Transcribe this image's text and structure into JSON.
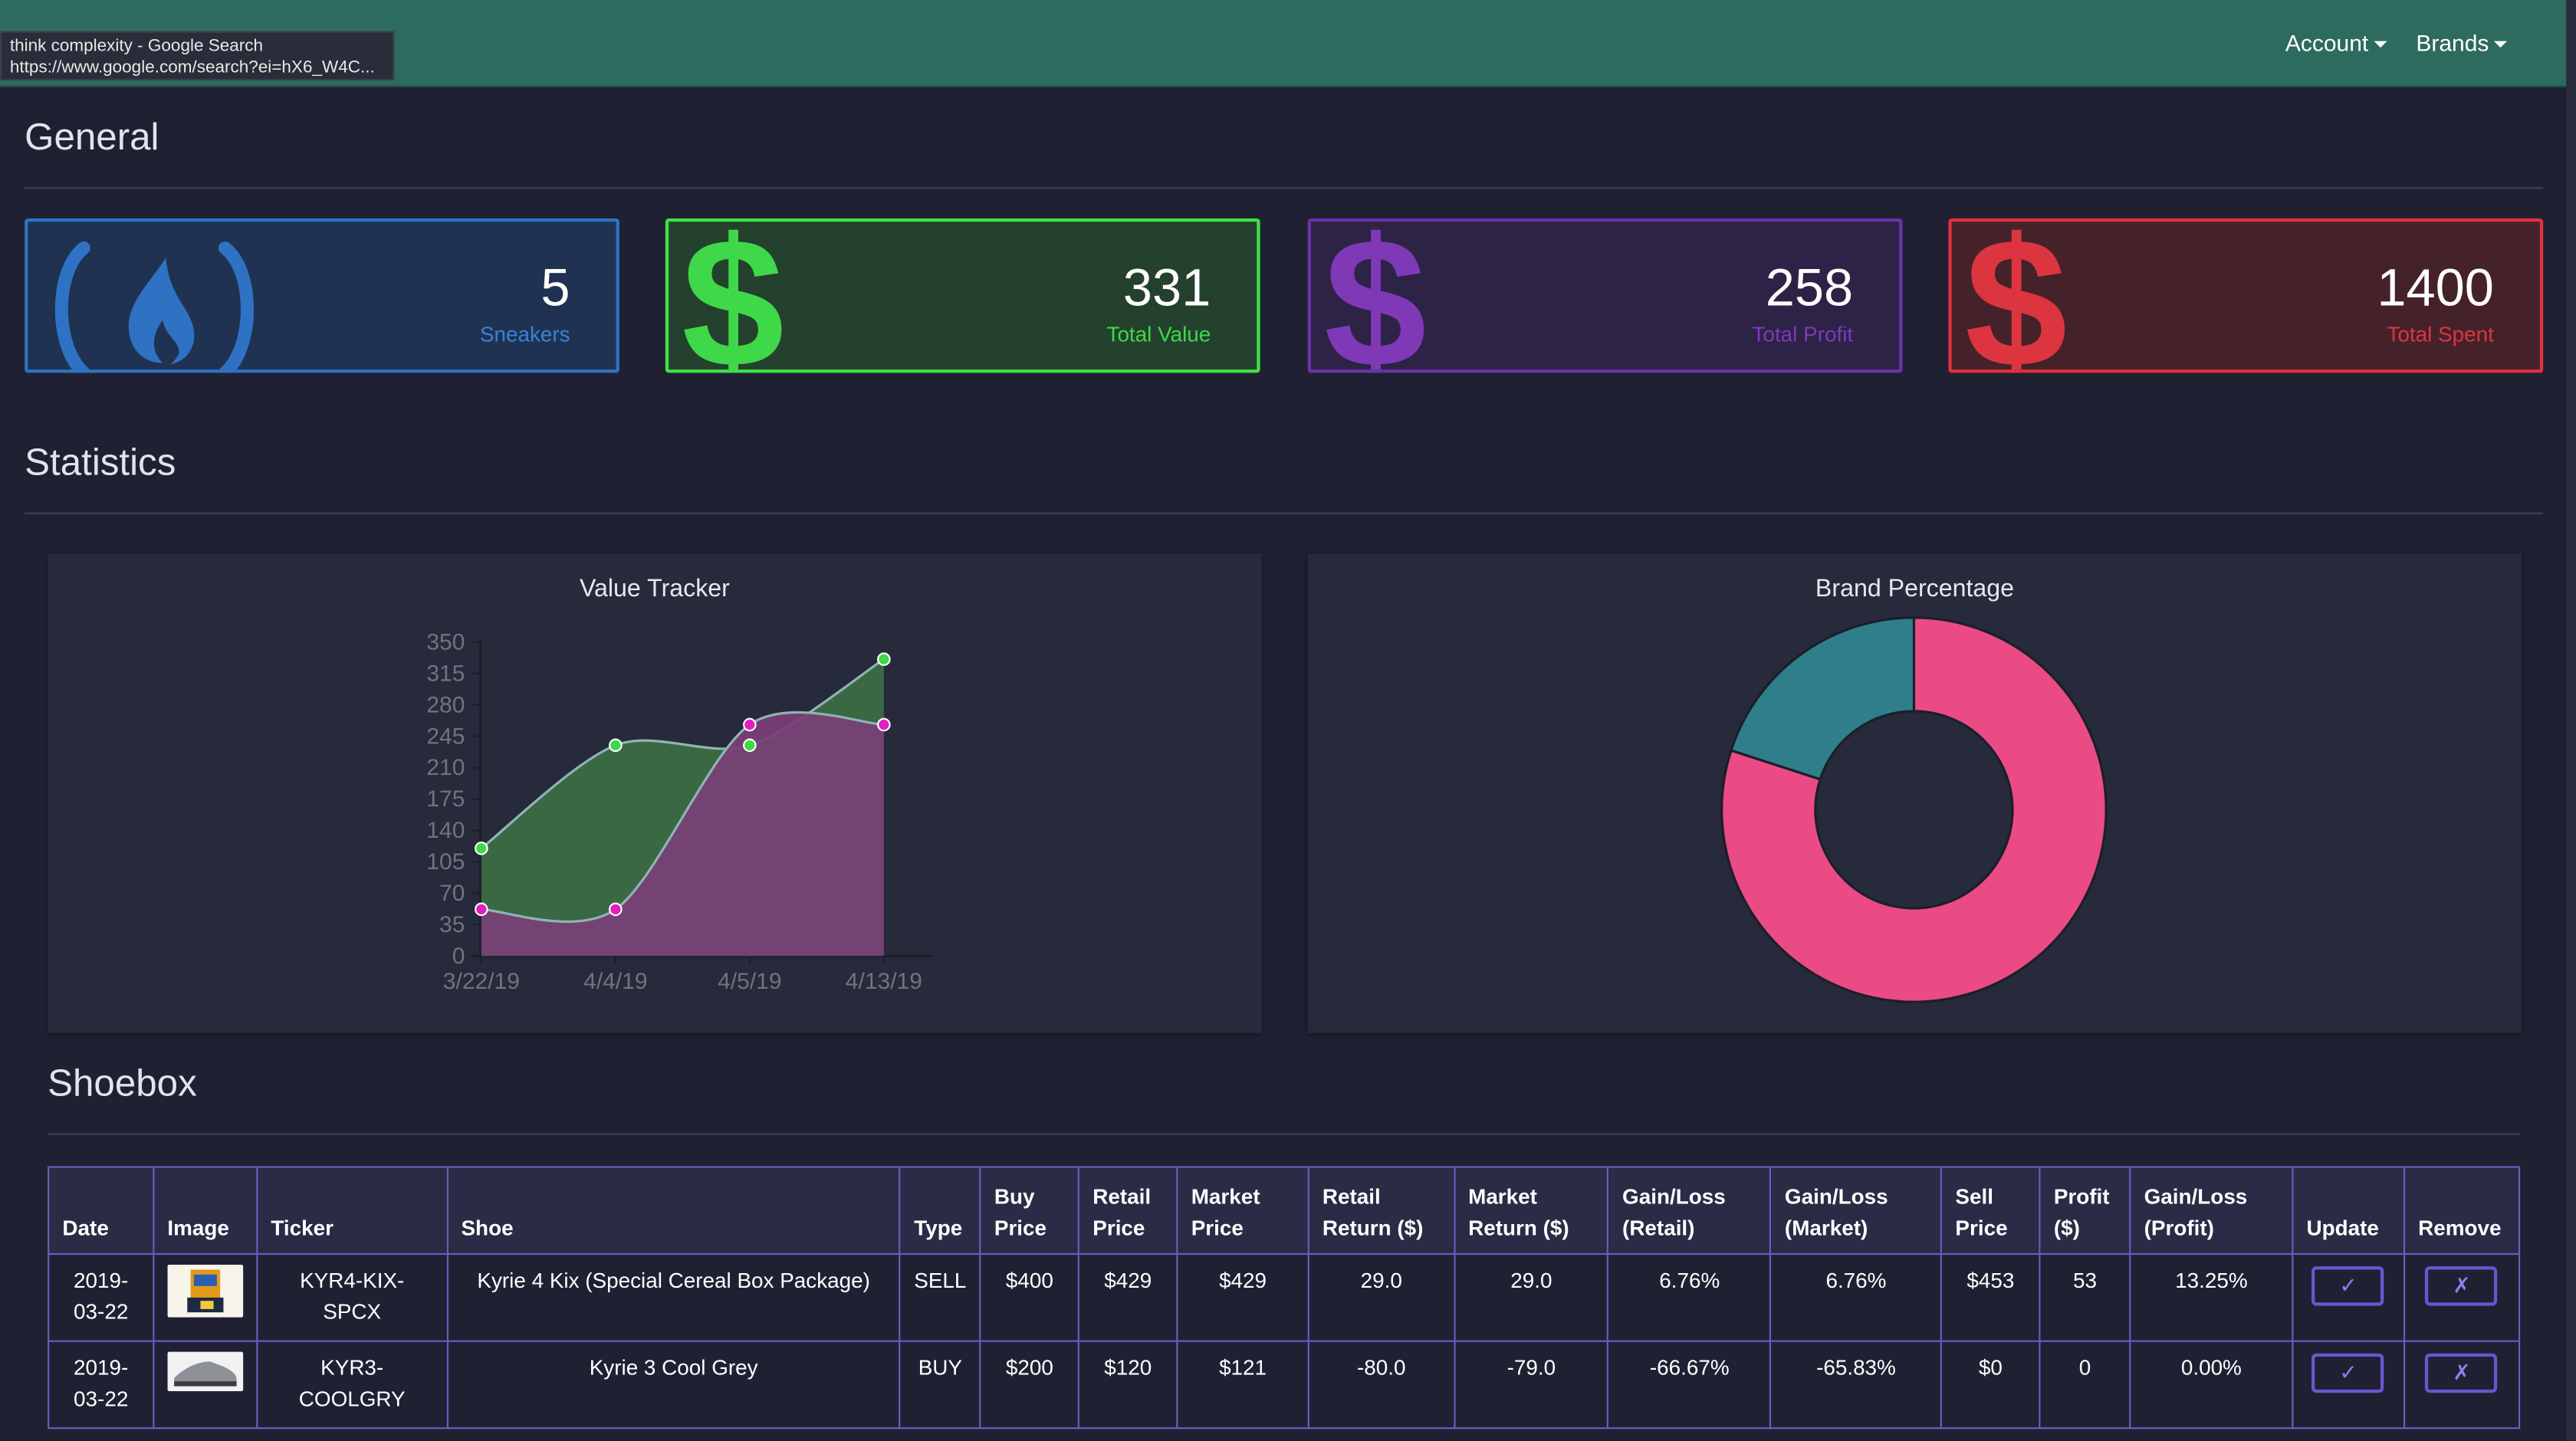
{
  "browser_tooltip": {
    "title": "think complexity - Google Search",
    "url": "https://www.google.com/search?ei=hX6_W4C..."
  },
  "navbar": {
    "menus": [
      {
        "label": "Account"
      },
      {
        "label": "Brands"
      }
    ]
  },
  "general": {
    "heading": "General",
    "cards": [
      {
        "value": "5",
        "label": "Sneakers",
        "icon": "freecodecamp-icon",
        "color": "#2f72c4"
      },
      {
        "value": "331",
        "label": "Total Value",
        "icon": "dollar-icon",
        "color": "#3ee247"
      },
      {
        "value": "258",
        "label": "Total Profit",
        "icon": "dollar-icon",
        "color": "#7f39b7"
      },
      {
        "value": "1400",
        "label": "Total Spent",
        "icon": "dollar-icon",
        "color": "#e1313c"
      }
    ]
  },
  "statistics": {
    "heading": "Statistics"
  },
  "chart_data": [
    {
      "type": "area",
      "title": "Value Tracker",
      "categories": [
        "3/22/19",
        "4/4/19",
        "4/5/19",
        "4/13/19"
      ],
      "y_ticks": [
        0,
        35,
        70,
        105,
        140,
        175,
        210,
        245,
        280,
        315,
        350
      ],
      "ylim": [
        0,
        350
      ],
      "series": [
        {
          "values": [
            120,
            235,
            235,
            331
          ],
          "color": "#3fd848",
          "fill": "#3b6b43"
        },
        {
          "values": [
            52,
            52,
            258,
            258
          ],
          "color": "#e020c0",
          "fill": "#7a3f77"
        }
      ]
    },
    {
      "type": "pie",
      "title": "Brand Percentage",
      "donut": true,
      "slices": [
        {
          "value": 80,
          "color": "#ea4b84"
        },
        {
          "value": 20,
          "color": "#2f7f8b"
        }
      ]
    }
  ],
  "shoebox": {
    "heading": "Shoebox",
    "columns": [
      "Date",
      "Image",
      "Ticker",
      "Shoe",
      "Type",
      "Buy Price",
      "Retail Price",
      "Market Price",
      "Retail Return ($)",
      "Market Return ($)",
      "Gain/Loss (Retail)",
      "Gain/Loss (Market)",
      "Sell Price",
      "Profit ($)",
      "Gain/Loss (Profit)",
      "Update",
      "Remove"
    ],
    "rows": [
      {
        "date": "2019-03-22",
        "ticker": "KYR4-KIX-SPCX",
        "shoe": "Kyrie 4 Kix (Special Cereal Box Package)",
        "type": "SELL",
        "buy": "$400",
        "retail": "$429",
        "market": "$429",
        "retail_return": "29.0",
        "market_return": "29.0",
        "gl_retail": "6.76%",
        "gl_market": "6.76%",
        "sell": "$453",
        "profit": "53",
        "gl_profit": "13.25%",
        "update": "✓",
        "remove": "✗"
      },
      {
        "date": "2019-03-22",
        "ticker": "KYR3-COOLGRY",
        "shoe": "Kyrie 3 Cool Grey",
        "type": "BUY",
        "buy": "$200",
        "retail": "$120",
        "market": "$121",
        "retail_return": "-80.0",
        "market_return": "-79.0",
        "gl_retail": "-66.67%",
        "gl_market": "-65.83%",
        "sell": "$0",
        "profit": "0",
        "gl_profit": "0.00%",
        "update": "✓",
        "remove": "✗"
      }
    ]
  }
}
